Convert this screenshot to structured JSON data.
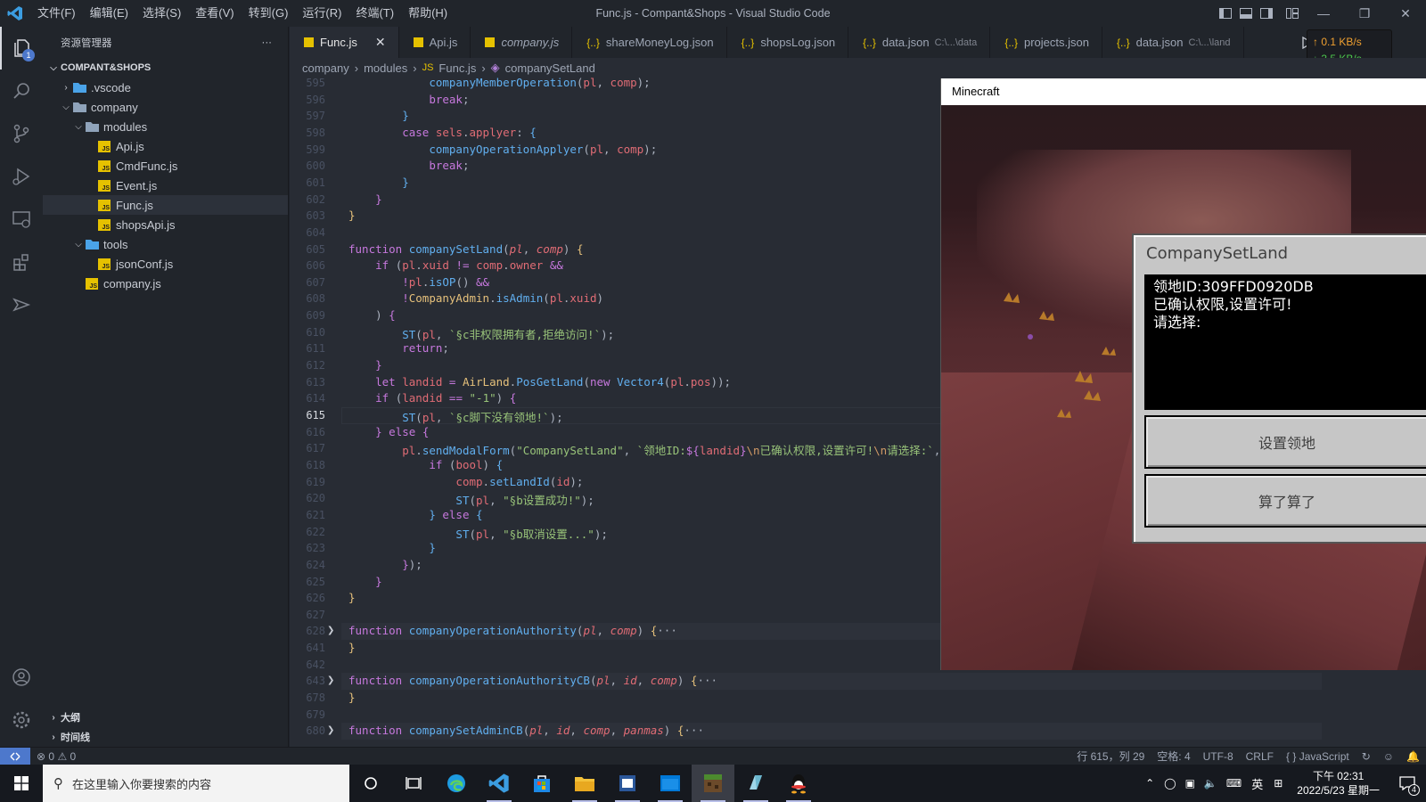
{
  "window": {
    "title": "Func.js - Compant&Shops - Visual Studio Code"
  },
  "menu": [
    "文件(F)",
    "编辑(E)",
    "选择(S)",
    "查看(V)",
    "转到(G)",
    "运行(R)",
    "终端(T)",
    "帮助(H)"
  ],
  "activity": {
    "explorer_badge": "1"
  },
  "sidebar": {
    "title": "资源管理器",
    "more": "···",
    "root": "COMPANT&SHOPS",
    "tree": [
      {
        "label": ".vscode",
        "indent": 1,
        "type": "folder-closed"
      },
      {
        "label": "company",
        "indent": 1,
        "type": "folder-open"
      },
      {
        "label": "modules",
        "indent": 2,
        "type": "folder-open"
      },
      {
        "label": "Api.js",
        "indent": 3,
        "type": "js"
      },
      {
        "label": "CmdFunc.js",
        "indent": 3,
        "type": "js"
      },
      {
        "label": "Event.js",
        "indent": 3,
        "type": "js"
      },
      {
        "label": "Func.js",
        "indent": 3,
        "type": "js",
        "selected": true
      },
      {
        "label": "shopsApi.js",
        "indent": 3,
        "type": "js"
      },
      {
        "label": "tools",
        "indent": 2,
        "type": "folder-open"
      },
      {
        "label": "jsonConf.js",
        "indent": 3,
        "type": "js"
      },
      {
        "label": "company.js",
        "indent": 2,
        "type": "js"
      }
    ],
    "outline": "大纲",
    "timeline": "时间线"
  },
  "tabs": [
    {
      "label": "Func.js",
      "kind": "js",
      "active": true,
      "close": "✕"
    },
    {
      "label": "Api.js",
      "kind": "js"
    },
    {
      "label": "company.js",
      "kind": "js",
      "italic": true
    },
    {
      "label": "shareMoneyLog.json",
      "kind": "json"
    },
    {
      "label": "shopsLog.json",
      "kind": "json"
    },
    {
      "label": "data.json",
      "kind": "json",
      "path": "C:\\...\\data"
    },
    {
      "label": "projects.json",
      "kind": "json"
    },
    {
      "label": "data.json",
      "kind": "json",
      "path": "C:\\...\\land"
    }
  ],
  "network": {
    "up": "↑ 0.1 KB/s",
    "down": "↓ 3.5 KB/s"
  },
  "breadcrumb": [
    "company",
    "modules",
    "Func.js",
    "companySetLand"
  ],
  "code": {
    "lines": [
      {
        "n": "595",
        "html": "            <span class='fn'>companyMemberOperation</span>(<span class='pr'>pl</span>, <span class='pr'>comp</span>);"
      },
      {
        "n": "596",
        "html": "            <span class='kw'>break</span>;"
      },
      {
        "n": "597",
        "html": "        <span class='fn'>}</span>"
      },
      {
        "n": "598",
        "html": "        <span class='kw'>case</span> <span class='pr'>sels</span>.<span class='pr'>applyer</span>: <span class='fn'>{</span>"
      },
      {
        "n": "599",
        "html": "            <span class='fn'>companyOperationApplyer</span>(<span class='pr'>pl</span>, <span class='pr'>comp</span>);"
      },
      {
        "n": "600",
        "html": "            <span class='kw'>break</span>;"
      },
      {
        "n": "601",
        "html": "        <span class='fn'>}</span>"
      },
      {
        "n": "602",
        "html": "    <span class='kw'>}</span>"
      },
      {
        "n": "603",
        "html": "<span class='ty'>}</span>"
      },
      {
        "n": "604",
        "html": ""
      },
      {
        "n": "605",
        "html": "<span class='kw'>function</span> <span class='fn'>companySetLand</span>(<span class='it'>pl</span>, <span class='it'>comp</span>) <span class='ty'>{</span>"
      },
      {
        "n": "606",
        "html": "    <span class='kw'>if</span> (<span class='pr'>pl</span>.<span class='pr'>xuid</span> <span class='kw'>!=</span> <span class='pr'>comp</span>.<span class='pr'>owner</span> <span class='kw'>&amp;&amp;</span>"
      },
      {
        "n": "607",
        "html": "        <span class='kw'>!</span><span class='pr'>pl</span>.<span class='fn'>isOP</span>() <span class='kw'>&amp;&amp;</span>"
      },
      {
        "n": "608",
        "html": "        <span class='kw'>!</span><span class='ty'>CompanyAdmin</span>.<span class='fn'>isAdmin</span>(<span class='pr'>pl</span>.<span class='pr'>xuid</span>)"
      },
      {
        "n": "609",
        "html": "    ) <span class='kw'>{</span>"
      },
      {
        "n": "610",
        "html": "        <span class='fn'>ST</span>(<span class='pr'>pl</span>, <span class='st'>`§c非权限拥有者,拒绝访问!`</span>);"
      },
      {
        "n": "611",
        "html": "        <span class='kw'>return</span>;"
      },
      {
        "n": "612",
        "html": "    <span class='kw'>}</span>"
      },
      {
        "n": "613",
        "html": "    <span class='kw'>let</span> <span class='pr'>landid</span> <span class='kw'>=</span> <span class='ty'>AirLand</span>.<span class='fn'>PosGetLand</span>(<span class='kw'>new</span> <span class='fn'>Vector4</span>(<span class='pr'>pl</span>.<span class='pr'>pos</span>));"
      },
      {
        "n": "614",
        "html": "    <span class='kw'>if</span> (<span class='pr'>landid</span> <span class='kw'>==</span> <span class='st'>\"-1\"</span>) <span class='kw'>{</span>"
      },
      {
        "n": "615",
        "html": "        <span class='fn'>ST</span>(<span class='pr'>pl</span>, <span class='st'>`§c脚下没有领地!`</span>);",
        "current": true
      },
      {
        "n": "616",
        "html": "    <span class='kw'>}</span> <span class='kw'>else</span> <span class='kw'>{</span>"
      },
      {
        "n": "617",
        "html": "        <span class='pr'>pl</span>.<span class='fn'>sendModalForm</span>(<span class='st'>\"CompanySetLand\"</span>, <span class='st'>`领地ID:</span><span class='kw'>${</span><span class='pr'>landid</span><span class='kw'>}</span><span class='nm'>\\n</span><span class='st'>已确认权限,设置许可!</span><span class='nm'>\\n</span><span class='st'>请选择:`</span>, <span class='st'>\"设置领地\"</span>, <span class='st'>\"算了算了\"</span>, (<span class='it'>pl</span>, <span class='it'>bool</span>) <span class='kw'>=&gt;</span> {"
      },
      {
        "n": "618",
        "html": "            <span class='kw'>if</span> (<span class='pr'>bool</span>) <span class='fn'>{</span>"
      },
      {
        "n": "619",
        "html": "                <span class='pr'>comp</span>.<span class='fn'>setLandId</span>(<span class='pr'>id</span>);"
      },
      {
        "n": "620",
        "html": "                <span class='fn'>ST</span>(<span class='pr'>pl</span>, <span class='st'>\"§b设置成功!\"</span>);"
      },
      {
        "n": "621",
        "html": "            <span class='fn'>}</span> <span class='kw'>else</span> <span class='fn'>{</span>"
      },
      {
        "n": "622",
        "html": "                <span class='fn'>ST</span>(<span class='pr'>pl</span>, <span class='st'>\"§b取消设置...\"</span>);"
      },
      {
        "n": "623",
        "html": "            <span class='fn'>}</span>"
      },
      {
        "n": "624",
        "html": "        <span class='kw'>}</span>);"
      },
      {
        "n": "625",
        "html": "    <span class='kw'>}</span>"
      },
      {
        "n": "626",
        "html": "<span class='ty'>}</span>"
      },
      {
        "n": "627",
        "html": ""
      },
      {
        "n": "628",
        "html": "<span class='kw'>function</span> <span class='fn'>companyOperationAuthority</span>(<span class='it'>pl</span>, <span class='it'>comp</span>) <span class='ty'>{</span><span class='pu'>···</span>",
        "fold": true
      },
      {
        "n": "641",
        "html": "<span class='ty'>}</span>"
      },
      {
        "n": "642",
        "html": ""
      },
      {
        "n": "643",
        "html": "<span class='kw'>function</span> <span class='fn'>companyOperationAuthorityCB</span>(<span class='it'>pl</span>, <span class='it'>id</span>, <span class='it'>comp</span>) <span class='ty'>{</span><span class='pu'>···</span>",
        "fold": true
      },
      {
        "n": "678",
        "html": "<span class='ty'>}</span>"
      },
      {
        "n": "679",
        "html": ""
      },
      {
        "n": "680",
        "html": "<span class='kw'>function</span> <span class='fn'>companySetAdminCB</span>(<span class='it'>pl</span>, <span class='it'>id</span>, <span class='it'>comp</span>, <span class='it'>panmas</span>) <span class='ty'>{</span><span class='pu'>···</span>",
        "fold": true
      }
    ]
  },
  "minecraft": {
    "window_title": "Minecraft",
    "dialog": {
      "title": "CompanySetLand",
      "content_lines": [
        "领地ID:309FFD0920DB",
        "已确认权限,设置许可!",
        "请选择:"
      ],
      "button1": "设置领地",
      "button2": "算了算了"
    }
  },
  "statusbar": {
    "errors": "0",
    "warnings": "0",
    "position": "行 615，列 29",
    "spaces": "空格: 4",
    "encoding": "UTF-8",
    "eol": "CRLF",
    "language": "JavaScript"
  },
  "taskbar": {
    "search_placeholder": "在这里输入你要搜索的内容",
    "ime": "英",
    "time": "下午 02:31",
    "date": "2022/5/23 星期一",
    "notifications": "4"
  }
}
